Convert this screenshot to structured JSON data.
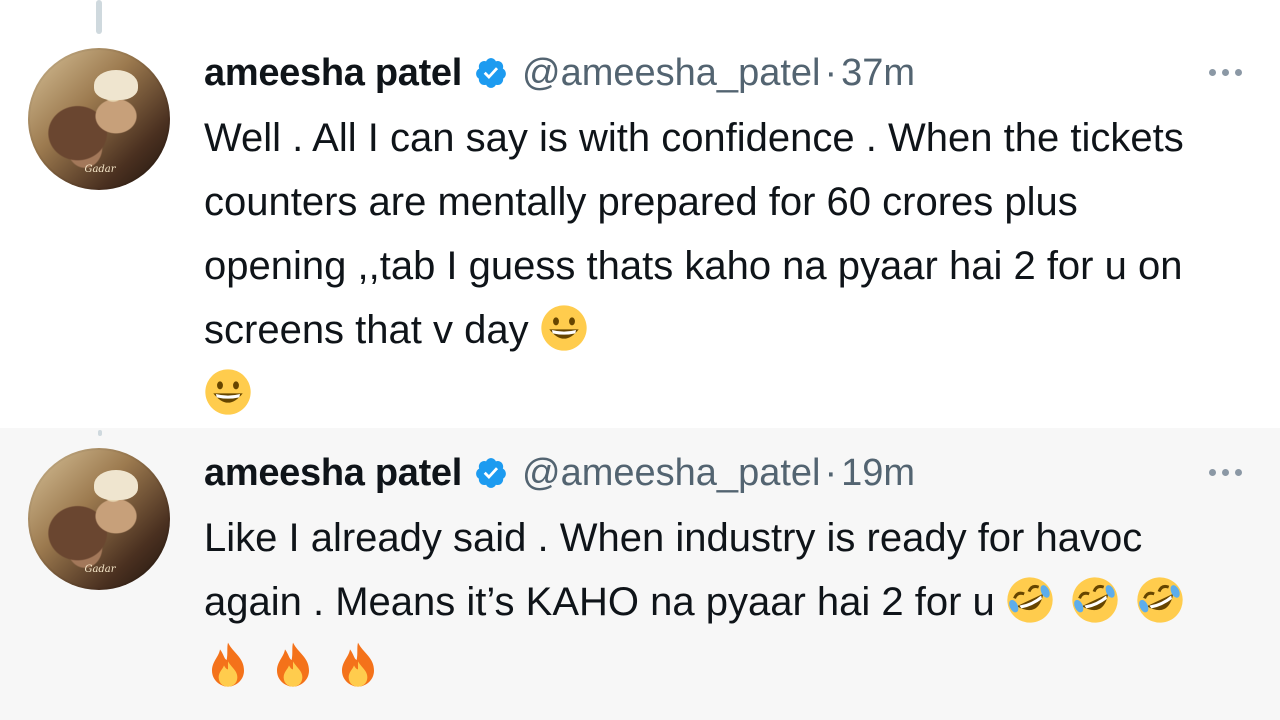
{
  "tweets": [
    {
      "name": "ameesha patel",
      "handle": "@ameesha_patel",
      "separator": "·",
      "time": "37m",
      "text": "Well . All I can say is with confidence . When the tickets counters are mentally prepared for 60 crores plus opening ,,tab I guess thats kaho na pyaar hai 2 for u on screens that v day",
      "trailing_emojis": [
        "grinning-face",
        "grinning-face"
      ],
      "avatar_label": "Gadar"
    },
    {
      "name": "ameesha patel",
      "handle": "@ameesha_patel",
      "separator": "·",
      "time": "19m",
      "text": "Like I already said . When industry is ready for havoc again . Means it’s KAHO na pyaar hai 2 for u",
      "trailing_emojis": [
        "rofl-face",
        "rofl-face",
        "rofl-face",
        "fire",
        "fire",
        "fire"
      ],
      "avatar_label": "Gadar"
    }
  ],
  "colors": {
    "verified_blue": "#1d9bf0",
    "secondary_text": "#536471",
    "primary_text": "#0f1419",
    "fire_orange": "#f4721a"
  }
}
